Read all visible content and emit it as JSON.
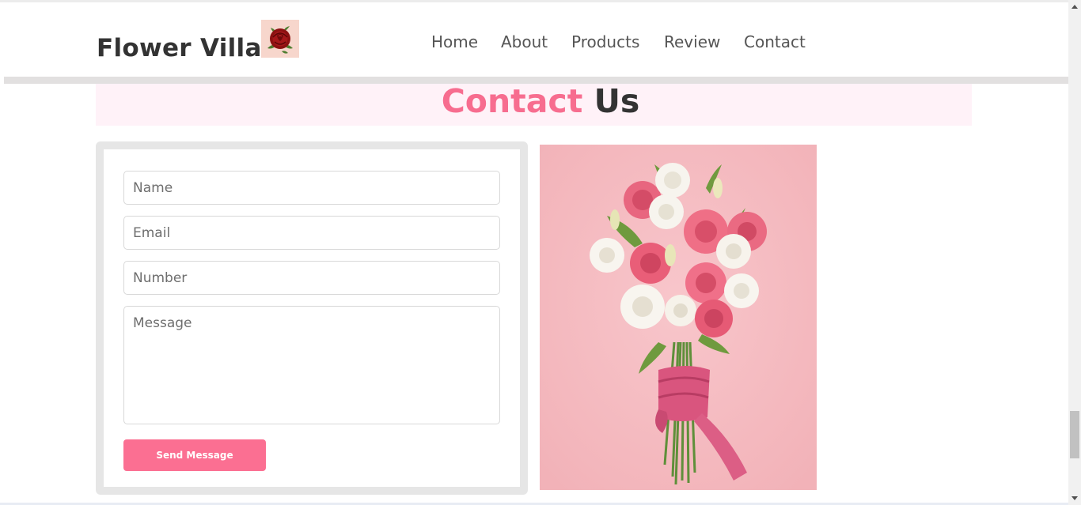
{
  "header": {
    "brand": "Flower Villa",
    "logo_icon": "rose-logo-icon",
    "nav": [
      "Home",
      "About",
      "Products",
      "Review",
      "Contact"
    ]
  },
  "contact": {
    "heading_accent": "Contact",
    "heading_rest": "Us",
    "form": {
      "name_placeholder": "Name",
      "email_placeholder": "Email",
      "number_placeholder": "Number",
      "message_placeholder": "Message",
      "submit_label": "Send Message"
    },
    "image_icon": "flower-bouquet-image"
  },
  "colors": {
    "accent": "#fb6f92",
    "heading_accent": "#f76d8f",
    "heading_band": "#fff2f8",
    "image_background": "#f5bcc2"
  }
}
